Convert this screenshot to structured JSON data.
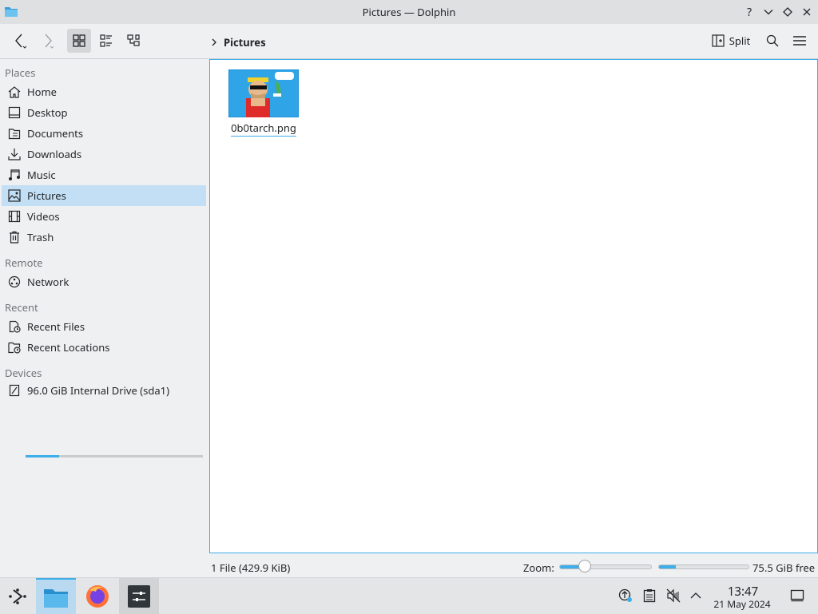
{
  "window": {
    "title": "Pictures — Dolphin",
    "controls": [
      "help",
      "minimize",
      "maximize",
      "close"
    ]
  },
  "toolbar": {
    "back_icon": "chevron-left-icon",
    "forward_icon": "chevron-right-icon",
    "view_modes": [
      "icons-view",
      "compact-view",
      "details-view"
    ],
    "active_view": "icons-view",
    "breadcrumb": [
      "Pictures"
    ],
    "split_label": "Split",
    "search_icon": "search-icon",
    "menu_icon": "hamburger-menu-icon"
  },
  "sidebar": {
    "places_heading": "Places",
    "places": [
      {
        "label": "Home",
        "icon": "home-icon"
      },
      {
        "label": "Desktop",
        "icon": "desktop-icon"
      },
      {
        "label": "Documents",
        "icon": "documents-icon"
      },
      {
        "label": "Downloads",
        "icon": "downloads-icon"
      },
      {
        "label": "Music",
        "icon": "music-icon"
      },
      {
        "label": "Pictures",
        "icon": "pictures-icon",
        "selected": true
      },
      {
        "label": "Videos",
        "icon": "videos-icon"
      },
      {
        "label": "Trash",
        "icon": "trash-icon"
      }
    ],
    "remote_heading": "Remote",
    "remote": [
      {
        "label": "Network",
        "icon": "network-icon"
      }
    ],
    "recent_heading": "Recent",
    "recent": [
      {
        "label": "Recent Files",
        "icon": "recent-files-icon"
      },
      {
        "label": "Recent Locations",
        "icon": "recent-locations-icon"
      }
    ],
    "devices_heading": "Devices",
    "devices": [
      {
        "label": "96.0 GiB Internal Drive (sda1)",
        "icon": "drive-icon",
        "usage_fraction": 0.19
      }
    ]
  },
  "content": {
    "files": [
      {
        "name": "0b0tarch.png",
        "thumbnail": "image-thumbnail"
      }
    ]
  },
  "statusbar": {
    "status_text": "1 File (429.9 KiB)",
    "zoom_label": "Zoom:",
    "zoom_fraction": 0.28,
    "free_space_text": "75.5 GiB free",
    "used_fraction": 0.19
  },
  "taskbar": {
    "launcher_icon": "application-launcher-icon",
    "tasks": [
      {
        "name": "dolphin",
        "icon": "folder-icon",
        "state": "active"
      },
      {
        "name": "firefox",
        "icon": "firefox-icon",
        "state": "idle"
      },
      {
        "name": "system-settings",
        "icon": "settings-icon",
        "state": "open"
      }
    ],
    "tray_icons": [
      "updates-icon",
      "clipboard-icon",
      "volume-muted-icon",
      "expand-tray-icon"
    ],
    "clock_time": "13:47",
    "clock_date": "21 May 2024",
    "show_desktop_icon": "show-desktop-icon",
    "accent": "#3daee9"
  }
}
